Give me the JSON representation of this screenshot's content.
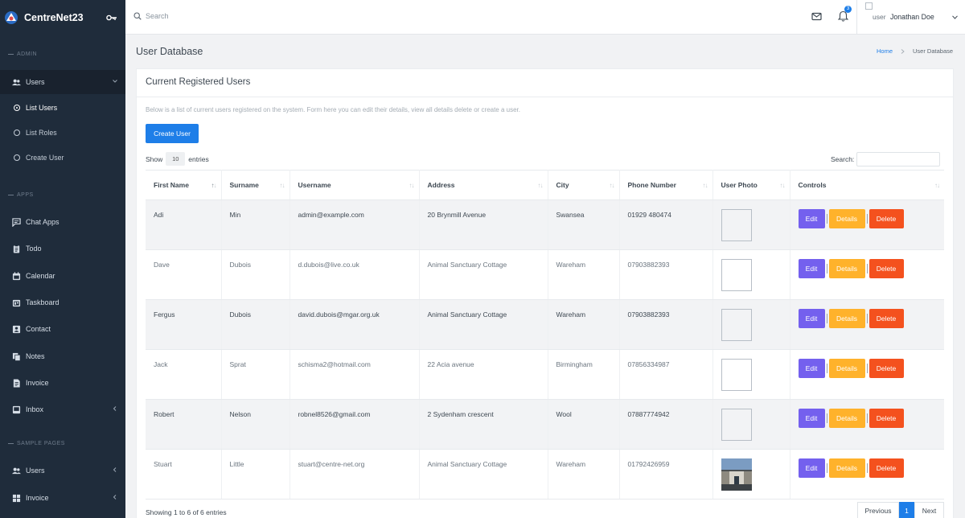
{
  "brand": {
    "name": "CentreNet23"
  },
  "sidebar": {
    "sections": [
      "ADMIN",
      "APPS",
      "SAMPLE PAGES"
    ],
    "users": "Users",
    "sub": [
      "List Users",
      "List Roles",
      "Create User"
    ],
    "apps": [
      "Chat Apps",
      "Todo",
      "Calendar",
      "Taskboard",
      "Contact",
      "Notes",
      "Invoice",
      "Inbox"
    ],
    "sample": [
      "Users",
      "Invoice"
    ]
  },
  "header": {
    "search_placeholder": "Search",
    "notif_count": "3",
    "user_alt": "user",
    "user_name": "Jonathan Doe"
  },
  "page": {
    "title": "User Database",
    "breadcrumb": [
      "Home",
      "User Database"
    ]
  },
  "card": {
    "title": "Current Registered Users",
    "description": "Below is a list of current users registered on the system. Form here you can edit their details, view all details delete or create a user.",
    "create_label": "Create User",
    "show_label": "Show",
    "show_value": "10",
    "entries_label": "entries",
    "search_label": "Search:"
  },
  "table": {
    "headers": [
      "First Name",
      "Surname",
      "Username",
      "Address",
      "City",
      "Phone Number",
      "User Photo",
      "Controls"
    ],
    "rows": [
      [
        "Adi",
        "Min",
        "admin@example.com",
        "20 Brynmill Avenue",
        "Swansea",
        "01929 480474"
      ],
      [
        "Dave",
        "Dubois",
        "d.dubois@live.co.uk",
        "Animal Sanctuary Cottage",
        "Wareham",
        "07903882393"
      ],
      [
        "Fergus",
        "Dubois",
        "david.dubois@mgar.org.uk",
        "Animal Sanctuary Cottage",
        "Wareham",
        "07903882393"
      ],
      [
        "Jack",
        "Sprat",
        "schisma2@hotmail.com",
        "22 Acia avenue",
        "Birmingham",
        "07856334987"
      ],
      [
        "Robert",
        "Nelson",
        "robnel8526@gmail.com",
        "2 Sydenham crescent",
        "Wool",
        "07887774942"
      ],
      [
        "Stuart",
        "Little",
        "stuart@centre-net.org",
        "Animal Sanctuary Cottage",
        "Wareham",
        "01792426959"
      ]
    ],
    "buttons": {
      "edit": "Edit",
      "details": "Details",
      "delete": "Delete"
    }
  },
  "footer": {
    "info": "Showing 1 to 6 of 6 entries",
    "prev": "Previous",
    "page": "1",
    "next": "Next"
  }
}
